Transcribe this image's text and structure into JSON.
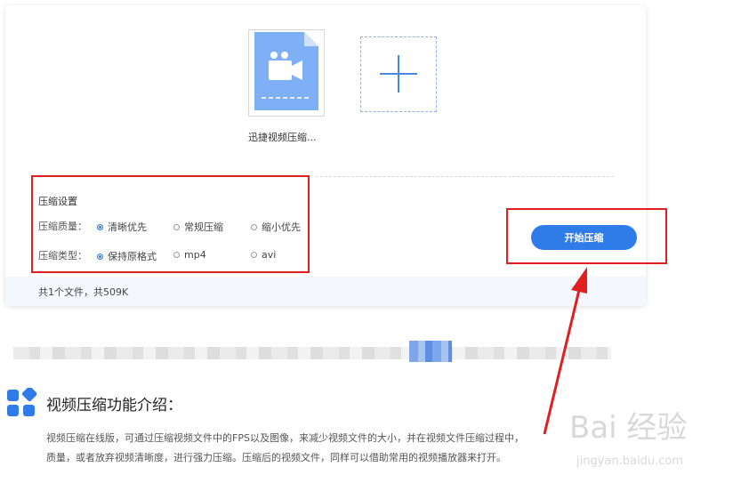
{
  "upload": {
    "file_name": "迅捷视频压缩...",
    "add_icon": "plus-icon",
    "file_icon": "video-camera-file-icon"
  },
  "settings": {
    "title": "压缩设置",
    "quality_label": "压缩质量：",
    "quality_options": [
      "清晰优先",
      "常规压缩",
      "缩小优先"
    ],
    "quality_selected": "清晰优先",
    "type_label": "压缩类型：",
    "type_options": [
      "保持原格式",
      "mp4",
      "avi"
    ],
    "type_selected": "保持原格式"
  },
  "actions": {
    "start_label": "开始压缩"
  },
  "status": {
    "summary": "共1个文件，共509K"
  },
  "intro": {
    "title": "视频压缩功能介绍：",
    "paragraph_line1": "视频压缩在线版，可通过压缩视频文件中的FPS以及图像，来减少视频文件的大小，并在视频文件压缩过程中，",
    "paragraph_line2": "质量，或者放弃视频清晰度，进行强力压缩。压缩后的视频文件，同样可以借助常用的视频播放器来打开。"
  },
  "watermark": {
    "brand": "Bai 经验",
    "url": "jingyan.baidu.com"
  },
  "colors": {
    "accent": "#2f7be8",
    "annotation_red": "#e02020",
    "file_icon_blue": "#7fb0f5"
  }
}
